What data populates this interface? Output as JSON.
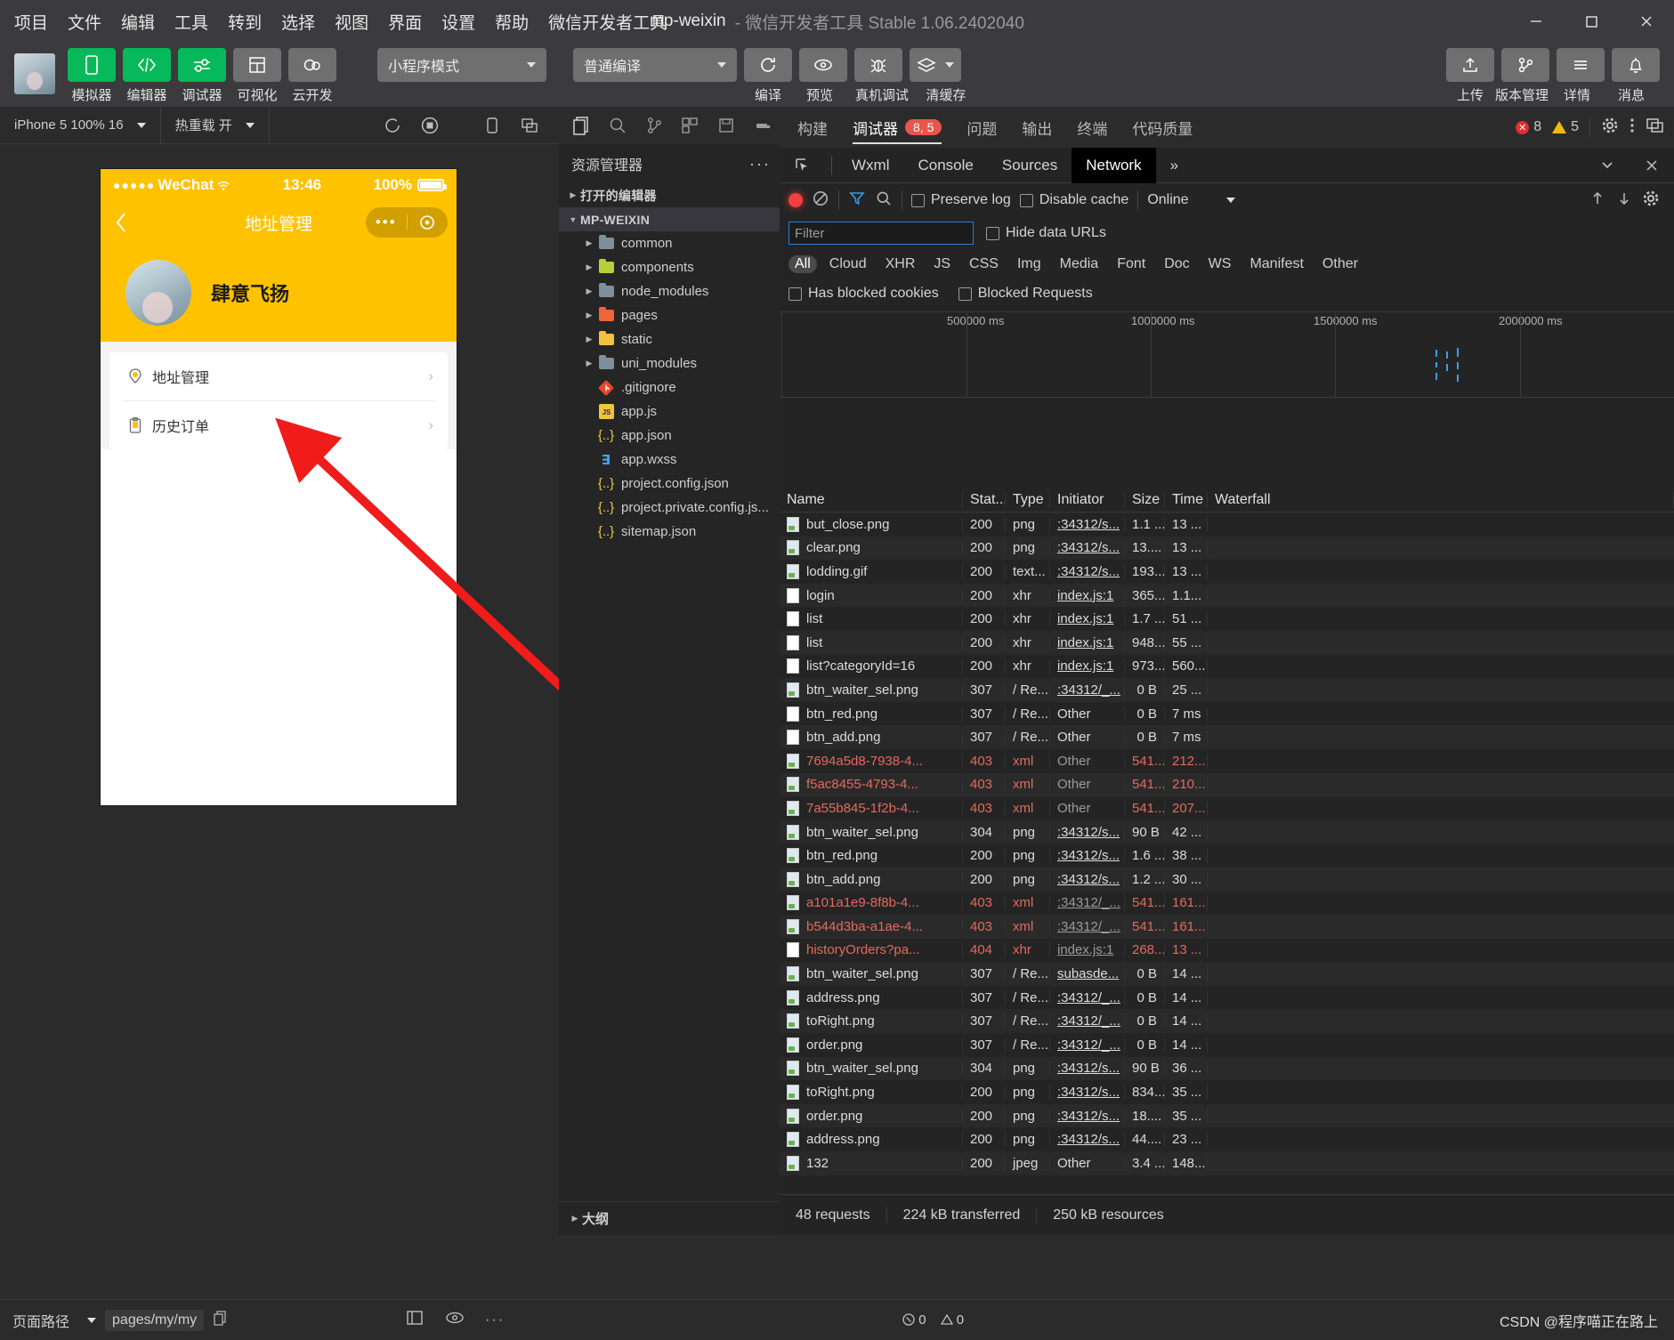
{
  "titlebar": {
    "menus": [
      "项目",
      "文件",
      "编辑",
      "工具",
      "转到",
      "选择",
      "视图",
      "界面",
      "设置",
      "帮助",
      "微信开发者工具"
    ],
    "project": "mp-weixin",
    "subtitle": "- 微信开发者工具 Stable 1.06.2402040",
    "minimize": "minimize-icon",
    "maximize": "maximize-icon",
    "close": "close-icon"
  },
  "toolbar": {
    "left_buttons": [
      {
        "label": "模拟器",
        "icon": "phone-icon",
        "style": "green"
      },
      {
        "label": "编辑器",
        "icon": "code-icon",
        "style": "green"
      },
      {
        "label": "调试器",
        "icon": "debug-icon",
        "style": "green"
      },
      {
        "label": "可视化",
        "icon": "layout-icon",
        "style": "grey"
      },
      {
        "label": "云开发",
        "icon": "cloud-icon",
        "style": "grey"
      }
    ],
    "mode_select": "小程序模式",
    "compile_select": "普通编译",
    "mid_buttons": [
      {
        "label": "编译",
        "icon": "refresh-icon"
      },
      {
        "label": "预览",
        "icon": "eye-icon"
      },
      {
        "label": "真机调试",
        "icon": "bug-icon"
      },
      {
        "label": "清缓存",
        "icon": "layers-icon"
      }
    ],
    "right_buttons": [
      {
        "label": "上传",
        "icon": "upload-icon"
      },
      {
        "label": "版本管理",
        "icon": "branch-icon"
      },
      {
        "label": "详情",
        "icon": "menu-icon"
      },
      {
        "label": "消息",
        "icon": "bell-icon"
      }
    ]
  },
  "simulator": {
    "device": "iPhone 5 100% 16",
    "hotreload": "热重载 开",
    "refresh_icon": "refresh-icon",
    "stop_icon": "stop-record-icon",
    "phone": {
      "status": {
        "carrier": "WeChat",
        "dots": "●●●●●",
        "time": "13:46",
        "battery": "100%"
      },
      "nav": {
        "back": "back-arrow-icon",
        "title": "地址管理",
        "capsule_dots": "•••",
        "capsule_target": "target-icon"
      },
      "profile": {
        "name": "肆意飞扬",
        "avatar": "user-avatar"
      },
      "list": [
        {
          "label": "地址管理",
          "icon": "location-pin-icon",
          "chevron": "›"
        },
        {
          "label": "历史订单",
          "icon": "clipboard-icon",
          "chevron": "›"
        }
      ]
    }
  },
  "explorer": {
    "activity_icons": [
      "files-icon",
      "search-icon",
      "source-control-icon",
      "extensions-icon",
      "save-icon",
      "docker-icon"
    ],
    "title": "资源管理器",
    "more": "···",
    "sections": [
      {
        "label": "打开的编辑器",
        "expanded": false
      },
      {
        "label": "MP-WEIXIN",
        "expanded": true
      }
    ],
    "tree": [
      {
        "name": "common",
        "type": "folder",
        "color": "grey"
      },
      {
        "name": "components",
        "type": "folder",
        "color": "green"
      },
      {
        "name": "node_modules",
        "type": "folder",
        "color": "grey"
      },
      {
        "name": "pages",
        "type": "folder",
        "color": "red"
      },
      {
        "name": "static",
        "type": "folder",
        "color": "yellow"
      },
      {
        "name": "uni_modules",
        "type": "folder",
        "color": "grey"
      },
      {
        "name": ".gitignore",
        "type": "file",
        "icon": "git-icon"
      },
      {
        "name": "app.js",
        "type": "file",
        "icon": "js-icon"
      },
      {
        "name": "app.json",
        "type": "file",
        "icon": "json-icon"
      },
      {
        "name": "app.wxss",
        "type": "file",
        "icon": "css-icon"
      },
      {
        "name": "project.config.json",
        "type": "file",
        "icon": "json-icon"
      },
      {
        "name": "project.private.config.js...",
        "type": "file",
        "icon": "json-icon"
      },
      {
        "name": "sitemap.json",
        "type": "file",
        "icon": "json-icon"
      }
    ],
    "outline": "大纲"
  },
  "devtools": {
    "tabs": [
      {
        "label": "构建",
        "active": false,
        "badge": null
      },
      {
        "label": "调试器",
        "active": true,
        "badge": "8, 5"
      },
      {
        "label": "问题",
        "active": false,
        "badge": null
      },
      {
        "label": "输出",
        "active": false,
        "badge": null
      },
      {
        "label": "终端",
        "active": false,
        "badge": null
      },
      {
        "label": "代码质量",
        "active": false,
        "badge": null
      }
    ],
    "error_count": "8",
    "warn_count": "5",
    "gear_icon": "gear-icon",
    "kebab_icon": "more-vertical-icon",
    "dock_icon": "dock-panel-icon",
    "close_icon": "close-icon",
    "collapse_icon": "chevron-down-icon",
    "panel_tabs": [
      {
        "label": "Wxml",
        "active": false
      },
      {
        "label": "Console",
        "active": false
      },
      {
        "label": "Sources",
        "active": false
      },
      {
        "label": "Network",
        "active": true
      }
    ],
    "panel_more": "»",
    "inspect_icon": "inspect-cursor-icon",
    "network": {
      "record_icon": "record-icon",
      "clear_icon": "clear-icon",
      "filter_icon": "funnel-icon",
      "search_icon": "search-icon",
      "preserve_log": "Preserve log",
      "disable_cache": "Disable cache",
      "throttle": "Online",
      "import_icon": "import-icon",
      "export_icon": "export-icon",
      "settings_icon": "gear-icon",
      "filter_placeholder": "Filter",
      "filter_value": "",
      "hide_data_urls": "Hide data URLs",
      "types": [
        "All",
        "Cloud",
        "XHR",
        "JS",
        "CSS",
        "Img",
        "Media",
        "Font",
        "Doc",
        "WS",
        "Manifest",
        "Other"
      ],
      "active_type": "All",
      "has_blocked_cookies": "Has blocked cookies",
      "blocked_requests": "Blocked Requests",
      "timeline_ticks": [
        "500000 ms",
        "1000000 ms",
        "1500000 ms",
        "2000000 ms"
      ],
      "columns": [
        "Name",
        "Stat...",
        "Type",
        "Initiator",
        "Size",
        "Time",
        "Waterfall"
      ],
      "rows": [
        {
          "name": "but_close.png",
          "status": "200",
          "type": "png",
          "initiator": ":34312/s...",
          "size": "1.1 ...",
          "time": "13 ...",
          "err": false,
          "icon": "image-file-icon",
          "link": true
        },
        {
          "name": "clear.png",
          "status": "200",
          "type": "png",
          "initiator": ":34312/s...",
          "size": "13....",
          "time": "13 ...",
          "err": false,
          "icon": "image-file-icon",
          "link": true
        },
        {
          "name": "lodding.gif",
          "status": "200",
          "type": "text...",
          "initiator": ":34312/s...",
          "size": "193...",
          "time": "13 ...",
          "err": false,
          "icon": "image-file-icon",
          "link": true
        },
        {
          "name": "login",
          "status": "200",
          "type": "xhr",
          "initiator": "index.js:1",
          "size": "365...",
          "time": "1.1...",
          "err": false,
          "icon": "doc-file-icon",
          "link": true
        },
        {
          "name": "list",
          "status": "200",
          "type": "xhr",
          "initiator": "index.js:1",
          "size": "1.7 ...",
          "time": "51 ...",
          "err": false,
          "icon": "doc-file-icon",
          "link": true
        },
        {
          "name": "list",
          "status": "200",
          "type": "xhr",
          "initiator": "index.js:1",
          "size": "948...",
          "time": "55 ...",
          "err": false,
          "icon": "doc-file-icon",
          "link": true
        },
        {
          "name": "list?categoryId=16",
          "status": "200",
          "type": "xhr",
          "initiator": "index.js:1",
          "size": "973...",
          "time": "560...",
          "err": false,
          "icon": "doc-file-icon",
          "link": true
        },
        {
          "name": "btn_waiter_sel.png",
          "status": "307",
          "type": "/ Re...",
          "initiator": ":34312/_...",
          "size": "0 B",
          "time": "25 ...",
          "err": false,
          "icon": "image-file-icon",
          "link": true
        },
        {
          "name": "btn_red.png",
          "status": "307",
          "type": "/ Re...",
          "initiator": "Other",
          "size": "0 B",
          "time": "7 ms",
          "err": false,
          "icon": "doc-file-icon",
          "link": false
        },
        {
          "name": "btn_add.png",
          "status": "307",
          "type": "/ Re...",
          "initiator": "Other",
          "size": "0 B",
          "time": "7 ms",
          "err": false,
          "icon": "doc-file-icon",
          "link": false
        },
        {
          "name": "7694a5d8-7938-4...",
          "status": "403",
          "type": "xml",
          "initiator": "Other",
          "size": "541...",
          "time": "212...",
          "err": true,
          "icon": "image-file-icon",
          "link": false
        },
        {
          "name": "f5ac8455-4793-4...",
          "status": "403",
          "type": "xml",
          "initiator": "Other",
          "size": "541...",
          "time": "210...",
          "err": true,
          "icon": "image-file-icon",
          "link": false
        },
        {
          "name": "7a55b845-1f2b-4...",
          "status": "403",
          "type": "xml",
          "initiator": "Other",
          "size": "541...",
          "time": "207...",
          "err": true,
          "icon": "image-file-icon",
          "link": false
        },
        {
          "name": "btn_waiter_sel.png",
          "status": "304",
          "type": "png",
          "initiator": ":34312/s...",
          "size": "90 B",
          "time": "42 ...",
          "err": false,
          "icon": "image-file-icon",
          "link": true
        },
        {
          "name": "btn_red.png",
          "status": "200",
          "type": "png",
          "initiator": ":34312/s...",
          "size": "1.6 ...",
          "time": "38 ...",
          "err": false,
          "icon": "image-file-icon",
          "link": true
        },
        {
          "name": "btn_add.png",
          "status": "200",
          "type": "png",
          "initiator": ":34312/s...",
          "size": "1.2 ...",
          "time": "30 ...",
          "err": false,
          "icon": "image-file-icon",
          "link": true
        },
        {
          "name": "a101a1e9-8f8b-4...",
          "status": "403",
          "type": "xml",
          "initiator": ":34312/_...",
          "size": "541...",
          "time": "161...",
          "err": true,
          "icon": "image-file-icon",
          "link": true
        },
        {
          "name": "b544d3ba-a1ae-4...",
          "status": "403",
          "type": "xml",
          "initiator": ":34312/_...",
          "size": "541...",
          "time": "161...",
          "err": true,
          "icon": "image-file-icon",
          "link": true
        },
        {
          "name": "historyOrders?pa...",
          "status": "404",
          "type": "xhr",
          "initiator": "index.js:1",
          "size": "268...",
          "time": "13 ...",
          "err": true,
          "icon": "doc-file-icon",
          "link": true
        },
        {
          "name": "btn_waiter_sel.png",
          "status": "307",
          "type": "/ Re...",
          "initiator": "subasde...",
          "size": "0 B",
          "time": "14 ...",
          "err": false,
          "icon": "image-file-icon",
          "link": true
        },
        {
          "name": "address.png",
          "status": "307",
          "type": "/ Re...",
          "initiator": ":34312/_...",
          "size": "0 B",
          "time": "14 ...",
          "err": false,
          "icon": "image-file-icon",
          "link": true
        },
        {
          "name": "toRight.png",
          "status": "307",
          "type": "/ Re...",
          "initiator": ":34312/_...",
          "size": "0 B",
          "time": "14 ...",
          "err": false,
          "icon": "image-file-icon",
          "link": true
        },
        {
          "name": "order.png",
          "status": "307",
          "type": "/ Re...",
          "initiator": ":34312/_...",
          "size": "0 B",
          "time": "14 ...",
          "err": false,
          "icon": "image-file-icon",
          "link": true
        },
        {
          "name": "btn_waiter_sel.png",
          "status": "304",
          "type": "png",
          "initiator": ":34312/s...",
          "size": "90 B",
          "time": "36 ...",
          "err": false,
          "icon": "image-file-icon",
          "link": true
        },
        {
          "name": "toRight.png",
          "status": "200",
          "type": "png",
          "initiator": ":34312/s...",
          "size": "834...",
          "time": "35 ...",
          "err": false,
          "icon": "image-file-icon",
          "link": true
        },
        {
          "name": "order.png",
          "status": "200",
          "type": "png",
          "initiator": ":34312/s...",
          "size": "18....",
          "time": "35 ...",
          "err": false,
          "icon": "image-file-icon",
          "link": true
        },
        {
          "name": "address.png",
          "status": "200",
          "type": "png",
          "initiator": ":34312/s...",
          "size": "44....",
          "time": "23 ...",
          "err": false,
          "icon": "image-file-icon",
          "link": true
        },
        {
          "name": "132",
          "status": "200",
          "type": "jpeg",
          "initiator": "Other",
          "size": "3.4 ...",
          "time": "148...",
          "err": false,
          "icon": "image-file-icon",
          "link": false
        }
      ],
      "footer": {
        "requests": "48 requests",
        "transferred": "224 kB transferred",
        "resources": "250 kB resources"
      }
    }
  },
  "statusbar": {
    "page_path_label": "页面路径",
    "page_path_value": "pages/my/my",
    "copy_icon": "copy-icon",
    "wxml_icon": "wxml-panel-icon",
    "eye_icon": "eye-icon",
    "more_icon": "more-icon",
    "error_count": "0",
    "warn_count": "0",
    "watermark": "CSDN @程序喵正在路上"
  },
  "colors": {
    "accent_green": "#07b95a",
    "wechat_yellow": "#ffc200",
    "error_red": "#e8554a",
    "link_blue": "#2a7fd4"
  }
}
